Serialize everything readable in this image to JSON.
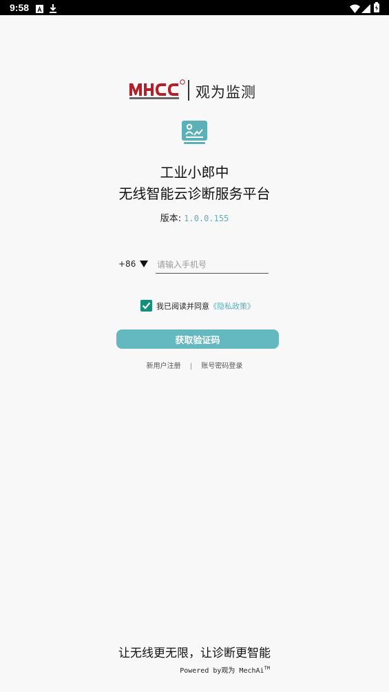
{
  "status_bar": {
    "time": "9:58",
    "icons": [
      "a-icon",
      "download-icon",
      "wifi-icon",
      "signal-icon",
      "battery-icon"
    ]
  },
  "logo": {
    "brand": "MHCC",
    "tagline": "观为监测"
  },
  "app": {
    "title_line1": "工业小郎中",
    "title_line2": "无线智能云诊断服务平台",
    "version_label": "版本:",
    "version_number": "1.0.0.155"
  },
  "login": {
    "country_code": "+86",
    "phone_placeholder": "请输入手机号",
    "agree_text": "我已阅读并同意",
    "privacy_link": "《隐私政策》",
    "agree_checked": true,
    "get_code_button": "获取验证码",
    "register_link": "新用户注册",
    "separator": "|",
    "password_login_link": "账号密码登录"
  },
  "footer": {
    "slogan": "让无线更无限，让诊断更智能",
    "powered_by": "Powered by观为 MechAi",
    "trademark": "TM"
  },
  "colors": {
    "accent": "#64b8bf",
    "checkbox": "#138f7c",
    "link": "#5aaebd",
    "brand_red": "#b3202a"
  }
}
